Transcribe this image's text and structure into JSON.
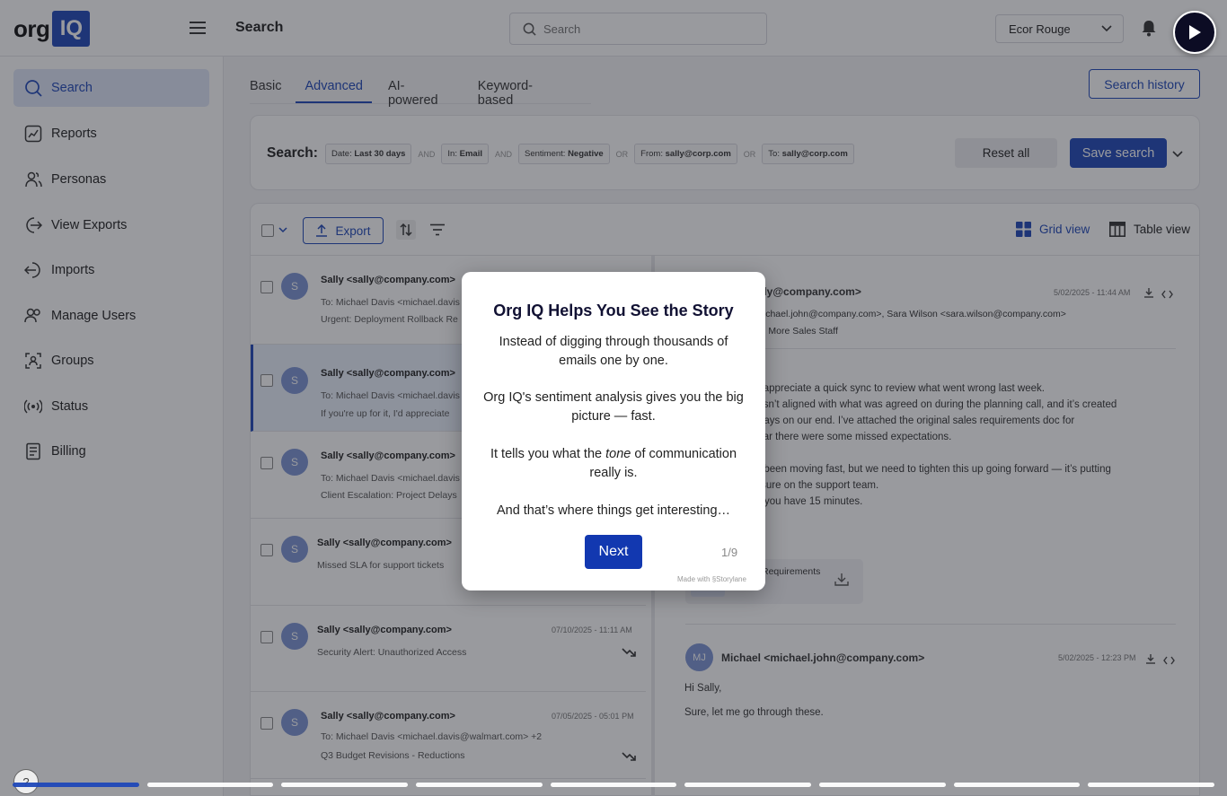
{
  "brand": {
    "logo_org": "org",
    "logo_iq": "IQ"
  },
  "header": {
    "title": "Search",
    "search_placeholder": "Search",
    "workspace": "Ecor Rouge"
  },
  "sidebar": {
    "items": [
      {
        "label": "Search",
        "icon": "search-icon"
      },
      {
        "label": "Reports",
        "icon": "reports-icon"
      },
      {
        "label": "Personas",
        "icon": "personas-icon"
      },
      {
        "label": "View Exports",
        "icon": "exports-icon"
      },
      {
        "label": "Imports",
        "icon": "imports-icon"
      },
      {
        "label": "Manage Users",
        "icon": "users-icon"
      },
      {
        "label": "Groups",
        "icon": "groups-icon"
      },
      {
        "label": "Status",
        "icon": "status-icon"
      },
      {
        "label": "Billing",
        "icon": "billing-icon"
      }
    ]
  },
  "tabs": [
    "Basic",
    "Advanced",
    "AI-powered",
    "Keyword-based"
  ],
  "search_history": "Search history",
  "query": {
    "label": "Search:",
    "chips": [
      {
        "key": "Date:",
        "value": "Last 30 days"
      },
      {
        "key": "In:",
        "value": "Email"
      },
      {
        "key": "Sentiment:",
        "value": "Negative"
      },
      {
        "key": "From:",
        "value": "sally@corp.com"
      },
      {
        "key": "To:",
        "value": "sally@corp.com"
      }
    ],
    "ops": [
      "AND",
      "AND",
      "OR",
      "OR"
    ],
    "reset": "Reset all",
    "save": "Save search"
  },
  "toolbar": {
    "export": "Export",
    "grid_view": "Grid view",
    "table_view": "Table view"
  },
  "emails": [
    {
      "avatar": "S",
      "from": "Sally <sally@company.com>",
      "to": "To: Michael Davis <michael.davis",
      "subject": "Urgent: Deployment Rollback Re",
      "date": ""
    },
    {
      "avatar": "S",
      "from": "Sally <sally@company.com>",
      "to": "To: Michael Davis <michael.davis",
      "subject": "If you're up for it, I'd appreciate",
      "date": ""
    },
    {
      "avatar": "S",
      "from": "Sally <sally@company.com>",
      "to": "To: Michael Davis <michael.davis",
      "subject": "Client Escalation: Project Delays",
      "date": ""
    },
    {
      "avatar": "S",
      "from": "Sally <sally@company.com>",
      "to": "",
      "subject": "Missed SLA for support tickets",
      "date": ""
    },
    {
      "avatar": "S",
      "from": "Sally <sally@company.com>",
      "to": "",
      "subject": "Security Alert: Unauthorized Access",
      "date": "07/10/2025 - 11:11 AM"
    },
    {
      "avatar": "S",
      "from": "Sally <sally@company.com>",
      "to": "To: Michael Davis <michael.davis@walmart.com> +2",
      "subject": "Q3 Budget Revisions - Reductions",
      "date": "07/05/2025 - 05:01 PM"
    }
  ],
  "detail": {
    "from": "lly@company.com>",
    "date1": "5/02/2025 - 11:44 AM",
    "recipients": "<michael.john@company.com>, Sara Wilson <sara.wilson@company.com>",
    "subject": "eed More Sales Staff",
    "body": [
      ", I’d appreciate a quick sync to review what went wrong last week.",
      "wasn’t aligned with what was agreed on during the planning call, and it’s created",
      "delays on our end. I’ve attached the original sales requirements doc for",
      "clear there were some missed expectations.",
      "",
      "ve been moving fast, but we need to tighten this up going forward — it’s putting",
      "essure on the support team.",
      "en you have 15 minutes."
    ],
    "attachment": "Requirements",
    "reply_avatar": "MJ",
    "reply_from": "Michael <michael.john@company.com>",
    "reply_date": "5/02/2025 - 12:23 PM",
    "reply_greeting": "Hi Sally,",
    "reply_body": "Sure, let me go through these."
  },
  "modal": {
    "title": "Org IQ Helps You See the Story",
    "p1": "Instead of digging through thousands of emails one by one.",
    "p2": "Org IQ's sentiment analysis gives you the big picture — fast.",
    "p3_pre": "It tells you what the ",
    "p3_em": "tone",
    "p3_post": " of communication really is.",
    "p4": "And that’s where things get interesting…",
    "next": "Next",
    "step": "1/9",
    "made_with": "Made with",
    "made_with_brand": "Storylane"
  },
  "progress": {
    "current": 1,
    "total": 9
  },
  "help": "?"
}
